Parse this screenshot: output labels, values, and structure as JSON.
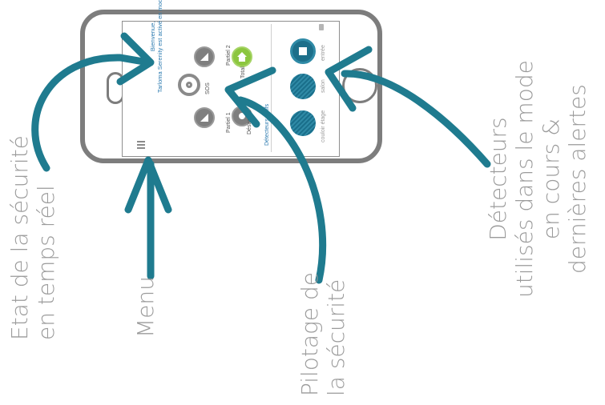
{
  "annotations": {
    "etat": [
      "Etat de la sécurité",
      "en temps réel"
    ],
    "menu": [
      "Menu"
    ],
    "pilotage": [
      "Pilotage de",
      "la sécurité"
    ],
    "detecteurs": [
      "Détecteurs",
      "utilisés dans le mode",
      "en cours &",
      "dernières alertes"
    ]
  },
  "screen": {
    "welcome": [
      "Bienvenue,",
      "Tarloma Serenity est activé en mode Total."
    ],
    "modes": {
      "partiel2": "Partiel 2",
      "total": "Total",
      "sos": "SOS",
      "partiel1": "Partiel 1",
      "desactive": "Désactivé"
    },
    "detectors_title": "Détecteurs actifs",
    "detectors": [
      "entrée",
      "salon",
      "couloir étage"
    ]
  },
  "colors": {
    "arrow": "#1f7b8f",
    "label": "#9b9b9b",
    "phone_frame": "#7d7d7d",
    "active_mode": "#8cc63f",
    "detector": "#1d6f8a"
  },
  "icons": {
    "menu": "hamburger-menu-icon",
    "mode_buttons": "shield-icon",
    "active_mode": "house-icon",
    "sos": "target-icon",
    "detectors": "motion-sensor-icon"
  }
}
